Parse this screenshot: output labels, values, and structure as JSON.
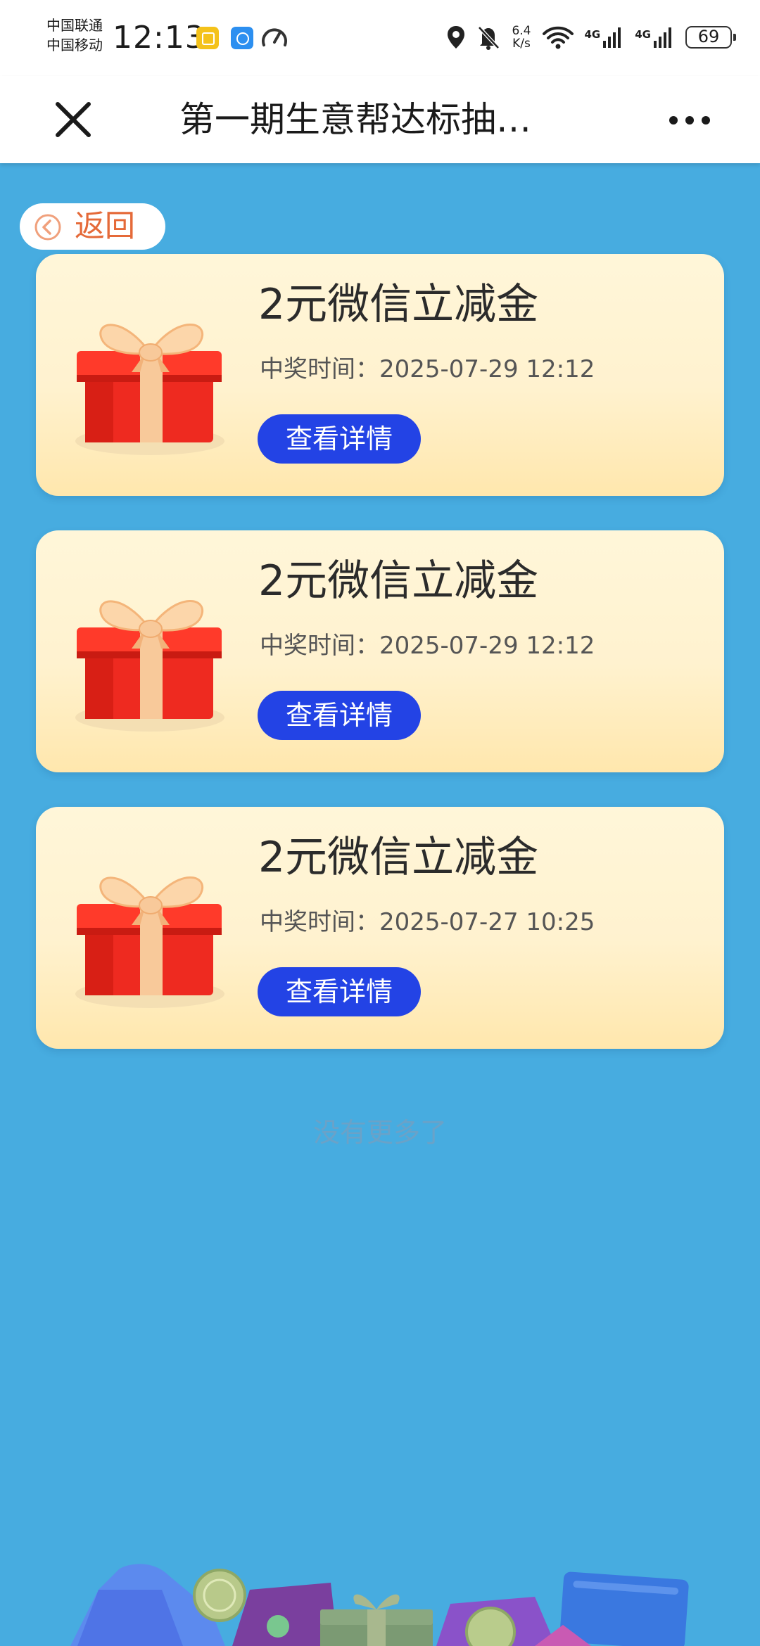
{
  "status_bar": {
    "carrier_1": "中国联通",
    "carrier_2": "中国移动",
    "time": "12:13",
    "net_speed_value": "6.4",
    "net_speed_unit": "K/s",
    "sim1_tag": "4G",
    "sim2_tag": "4G",
    "battery": "69",
    "icons": [
      "app-notification-icon",
      "weather-icon",
      "speedometer-icon",
      "location-icon",
      "bell-muted-icon",
      "wifi-icon",
      "signal-icon",
      "signal-icon",
      "battery-icon"
    ]
  },
  "title_bar": {
    "title": "第一期生意帮达标抽…",
    "close_icon": "close-icon",
    "more_icon": "more-icon"
  },
  "back_button": {
    "label": "返回",
    "icon": "chevron-left-circle-icon"
  },
  "prizes": [
    {
      "name": "2元微信立减金",
      "time_text": "中奖时间：2025-07-29 12:12",
      "button": "查看详情",
      "icon": "gift-box-icon"
    },
    {
      "name": "2元微信立减金",
      "time_text": "中奖时间：2025-07-29 12:12",
      "button": "查看详情",
      "icon": "gift-box-icon"
    },
    {
      "name": "2元微信立减金",
      "time_text": "中奖时间：2025-07-27 10:25",
      "button": "查看详情",
      "icon": "gift-box-icon"
    }
  ],
  "no_more_text": "没有更多了",
  "colors": {
    "background": "#47ace0",
    "card_top": "#fff6d9",
    "card_bottom": "#ffe7ad",
    "button": "#2343e5",
    "back_accent": "#e56a39",
    "gift_red": "#ee2a20",
    "ribbon": "#f8c99a"
  }
}
